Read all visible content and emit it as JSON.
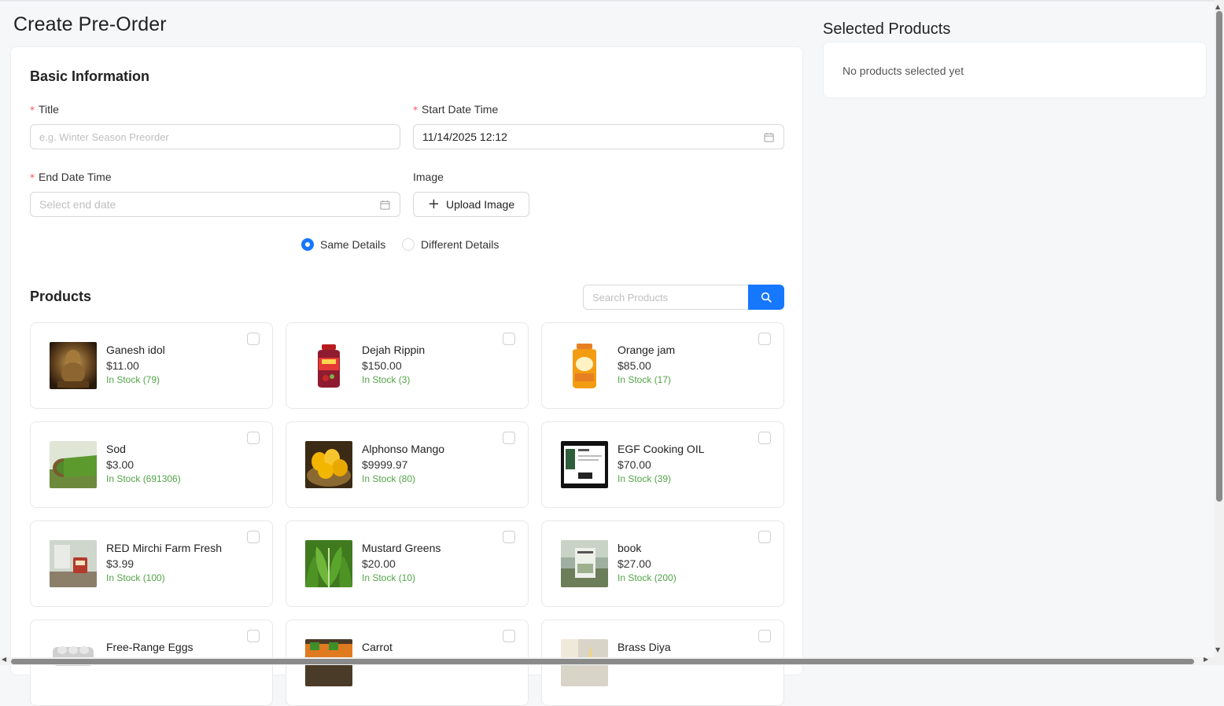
{
  "page": {
    "title": "Create Pre-Order"
  },
  "basic_info": {
    "heading": "Basic Information",
    "title_field": {
      "label": "Title",
      "placeholder": "e.g. Winter Season Preorder",
      "value": ""
    },
    "start_field": {
      "label": "Start Date Time",
      "value": "11/14/2025 12:12"
    },
    "end_field": {
      "label": "End Date Time",
      "placeholder": "Select end date"
    },
    "image_field": {
      "label": "Image",
      "button_label": "Upload Image"
    },
    "details_mode": {
      "options": [
        {
          "label": "Same Details",
          "selected": true
        },
        {
          "label": "Different Details",
          "selected": false
        }
      ]
    }
  },
  "products": {
    "heading": "Products",
    "search_placeholder": "Search Products",
    "items": [
      {
        "name": "Ganesh idol",
        "price": "$11.00",
        "stock": "In Stock (79)",
        "checked": false
      },
      {
        "name": "Dejah Rippin",
        "price": "$150.00",
        "stock": "In Stock (3)",
        "checked": false
      },
      {
        "name": "Orange jam",
        "price": "$85.00",
        "stock": "In Stock (17)",
        "checked": false
      },
      {
        "name": "Sod",
        "price": "$3.00",
        "stock": "In Stock (691306)",
        "checked": false
      },
      {
        "name": "Alphonso Mango",
        "price": "$9999.97",
        "stock": "In Stock (80)",
        "checked": false
      },
      {
        "name": "EGF Cooking OIL",
        "price": "$70.00",
        "stock": "In Stock (39)",
        "checked": false
      },
      {
        "name": "RED Mirchi Farm Fresh",
        "price": "$3.99",
        "stock": "In Stock (100)",
        "checked": false
      },
      {
        "name": "Mustard Greens",
        "price": "$20.00",
        "stock": "In Stock (10)",
        "checked": false
      },
      {
        "name": "book",
        "price": "$27.00",
        "stock": "In Stock (200)",
        "checked": false
      },
      {
        "name": "Free-Range Eggs",
        "price": "",
        "stock": "",
        "checked": false
      },
      {
        "name": "Carrot",
        "price": "",
        "stock": "",
        "checked": false
      },
      {
        "name": "Brass Diya",
        "price": "",
        "stock": "",
        "checked": false
      }
    ]
  },
  "selected_products": {
    "heading": "Selected Products",
    "empty_text": "No products selected yet"
  },
  "colors": {
    "primary": "#1677ff",
    "required": "#ff4d4f",
    "stock": "#52a447"
  }
}
